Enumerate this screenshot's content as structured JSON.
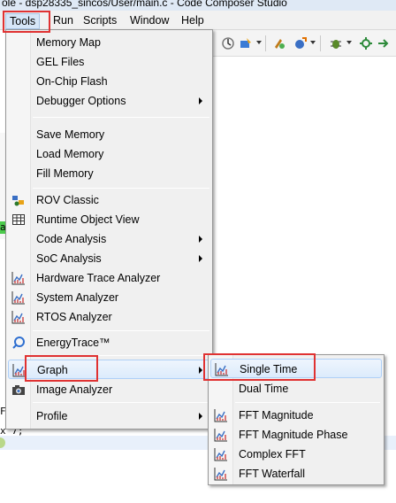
{
  "window": {
    "title": "ole - dsp28335_sincos/User/main.c - Code Composer Studio"
  },
  "menubar": {
    "items": [
      {
        "label": "Tools"
      },
      {
        "label": "Run"
      },
      {
        "label": "Scripts"
      },
      {
        "label": "Window"
      },
      {
        "label": "Help"
      }
    ]
  },
  "tools_menu": {
    "items": [
      {
        "label": "Memory Map"
      },
      {
        "label": "GEL Files"
      },
      {
        "label": "On-Chip Flash"
      },
      {
        "label": "Debugger Options"
      },
      {
        "label": "Save Memory"
      },
      {
        "label": "Load Memory"
      },
      {
        "label": "Fill Memory"
      },
      {
        "label": "ROV Classic"
      },
      {
        "label": "Runtime Object View"
      },
      {
        "label": "Code Analysis"
      },
      {
        "label": "SoC Analysis"
      },
      {
        "label": "Hardware Trace Analyzer"
      },
      {
        "label": "System Analyzer"
      },
      {
        "label": "RTOS Analyzer"
      },
      {
        "label": "EnergyTrace™"
      },
      {
        "label": "Graph"
      },
      {
        "label": "Image Analyzer"
      },
      {
        "label": "Profile"
      }
    ]
  },
  "graph_menu": {
    "items": [
      {
        "label": "Single Time"
      },
      {
        "label": "Dual Time"
      },
      {
        "label": "FFT Magnitude"
      },
      {
        "label": "FFT Magnitude Phase"
      },
      {
        "label": "Complex FFT"
      },
      {
        "label": "FFT Waterfall"
      }
    ]
  },
  "editor": {
    "fragments": [
      "a",
      "F",
      "x 7;"
    ]
  },
  "colors": {
    "annotation": "#e03232",
    "menu_bg": "#f0f0f0",
    "selection": "#dcebfc"
  },
  "icons": {
    "rov": "rov-classic-icon",
    "runtime": "grid-icon",
    "graph": "graph-icon",
    "energy": "energytrace-icon",
    "image": "camera-icon"
  }
}
